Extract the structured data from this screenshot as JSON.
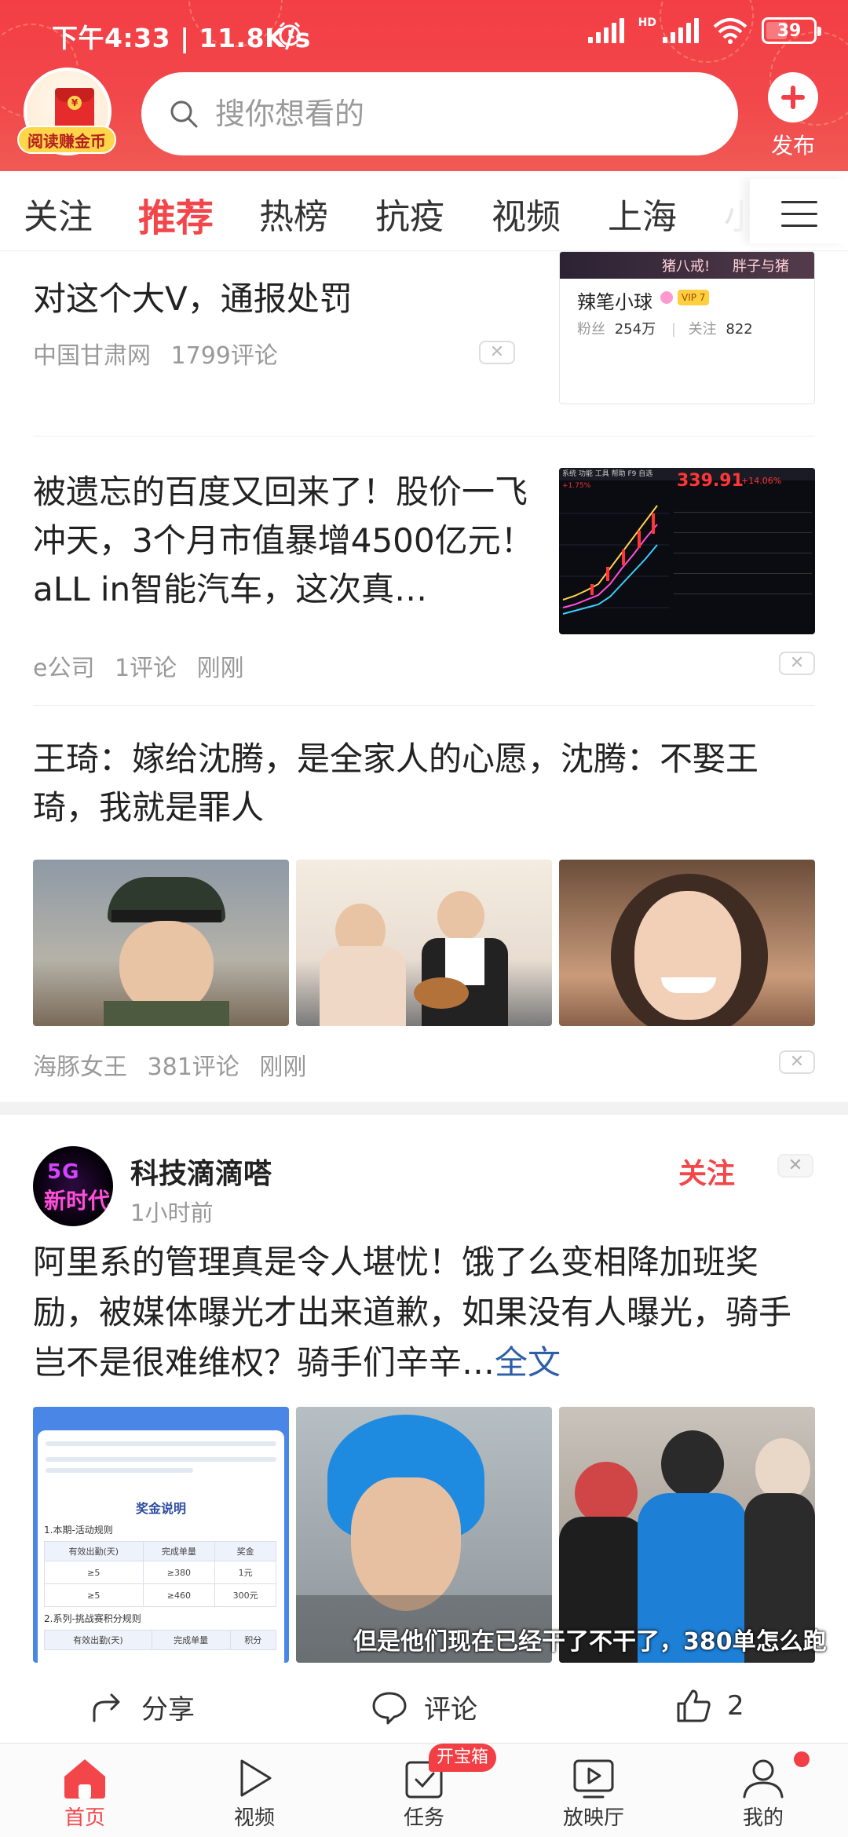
{
  "status_bar": {
    "time": "下午4:33 | 11.8K/s",
    "battery": "39",
    "hd": "HD"
  },
  "header": {
    "badge_label": "阅读赚金币",
    "search_placeholder": "搜你想看的",
    "publish_label": "发布",
    "accent_color": "#f33e45"
  },
  "tabs": [
    {
      "label": "关注"
    },
    {
      "label": "推荐",
      "active": true
    },
    {
      "label": "热榜"
    },
    {
      "label": "抗疫"
    },
    {
      "label": "视频"
    },
    {
      "label": "上海"
    },
    {
      "label": "小"
    }
  ],
  "articles": [
    {
      "title": "对这个大V，通报处罚",
      "source": "中国甘肃网",
      "comments": "1799评论",
      "thumb": {
        "name": "辣笔小球",
        "vip": "VIP 7",
        "fans_label": "粉丝",
        "fans": "254万",
        "follow_label": "关注",
        "follow": "822",
        "top_text_1": "猪八戒!",
        "top_text_2": "胖子与猪"
      }
    },
    {
      "title": "被遗忘的百度又回来了！股价一飞冲天，3个月市值暴增4500亿元！aLL in智能汽车，这次真…",
      "source": "e公司",
      "comments": "1评论",
      "time": "刚刚",
      "thumb": {
        "price": "339.91",
        "change": "+14.06%",
        "menu": "系统  功能  工具  帮助  F9  自选",
        "hk": "+1.75%"
      }
    },
    {
      "title": "王琦：嫁给沈腾，是全家人的心愿，沈腾：不娶王琦，我就是罪人",
      "source": "海豚女王",
      "comments": "381评论",
      "time": "刚刚"
    }
  ],
  "post": {
    "author": "科技滴滴嗒",
    "avatar_text_1": "5G",
    "avatar_text_2": "新时代",
    "time": "1小时前",
    "follow_label": "关注",
    "text": "阿里系的管理真是令人堪忧！饿了么变相降加班奖励，被媒体曝光才出来道歉，如果没有人曝光，骑手岂不是很难维权？骑手们辛辛…",
    "full_text_link": "全文",
    "image1": {
      "section_title": "奖金说明",
      "rule1": "1.本期-活动规则",
      "headers": [
        "有效出勤(天)",
        "完成单量",
        "奖金"
      ],
      "rows": [
        [
          "≥5",
          "≥380",
          "1元"
        ],
        [
          "≥5",
          "≥460",
          "300元"
        ]
      ],
      "rule2": "2.系列-挑战赛积分规则",
      "headers2": [
        "有效出勤(天)",
        "完成单量",
        "积分"
      ]
    },
    "subtitle": "但是他们现在已经干了不干了，380单怎么跑",
    "actions": {
      "share": "分享",
      "comment": "评论",
      "like_count": "2"
    }
  },
  "bottom_nav": [
    {
      "label": "首页",
      "icon": "home-icon",
      "active": true
    },
    {
      "label": "视频",
      "icon": "play-icon"
    },
    {
      "label": "任务",
      "icon": "task-icon",
      "badge": "开宝箱"
    },
    {
      "label": "放映厅",
      "icon": "screen-icon"
    },
    {
      "label": "我的",
      "icon": "user-icon"
    }
  ]
}
